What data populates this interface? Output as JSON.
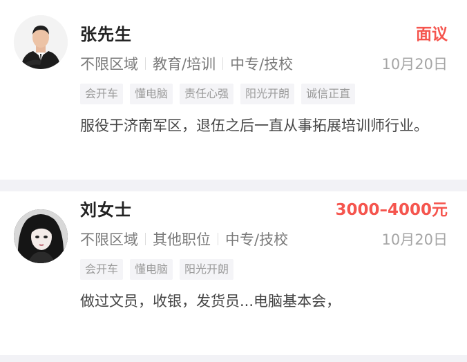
{
  "candidates": [
    {
      "name": "张先生",
      "salary": "面议",
      "meta": [
        "不限区域",
        "教育/培训",
        "中专/技校"
      ],
      "date": "10月20日",
      "tags": [
        "会开车",
        "懂电脑",
        "责任心强",
        "阳光开朗",
        "诚信正直"
      ],
      "desc": "服役于济南军区，退伍之后一直从事拓展培训师行业。"
    },
    {
      "name": "刘女士",
      "salary": "3000–4000元",
      "meta": [
        "不限区域",
        "其他职位",
        "中专/技校"
      ],
      "date": "10月20日",
      "tags": [
        "会开车",
        "懂电脑",
        "阳光开朗"
      ],
      "desc": "做过文员，收银，发货员...电脑基本会，"
    }
  ],
  "colors": {
    "salary": "#f5554e",
    "background": "#f2f2f6"
  }
}
